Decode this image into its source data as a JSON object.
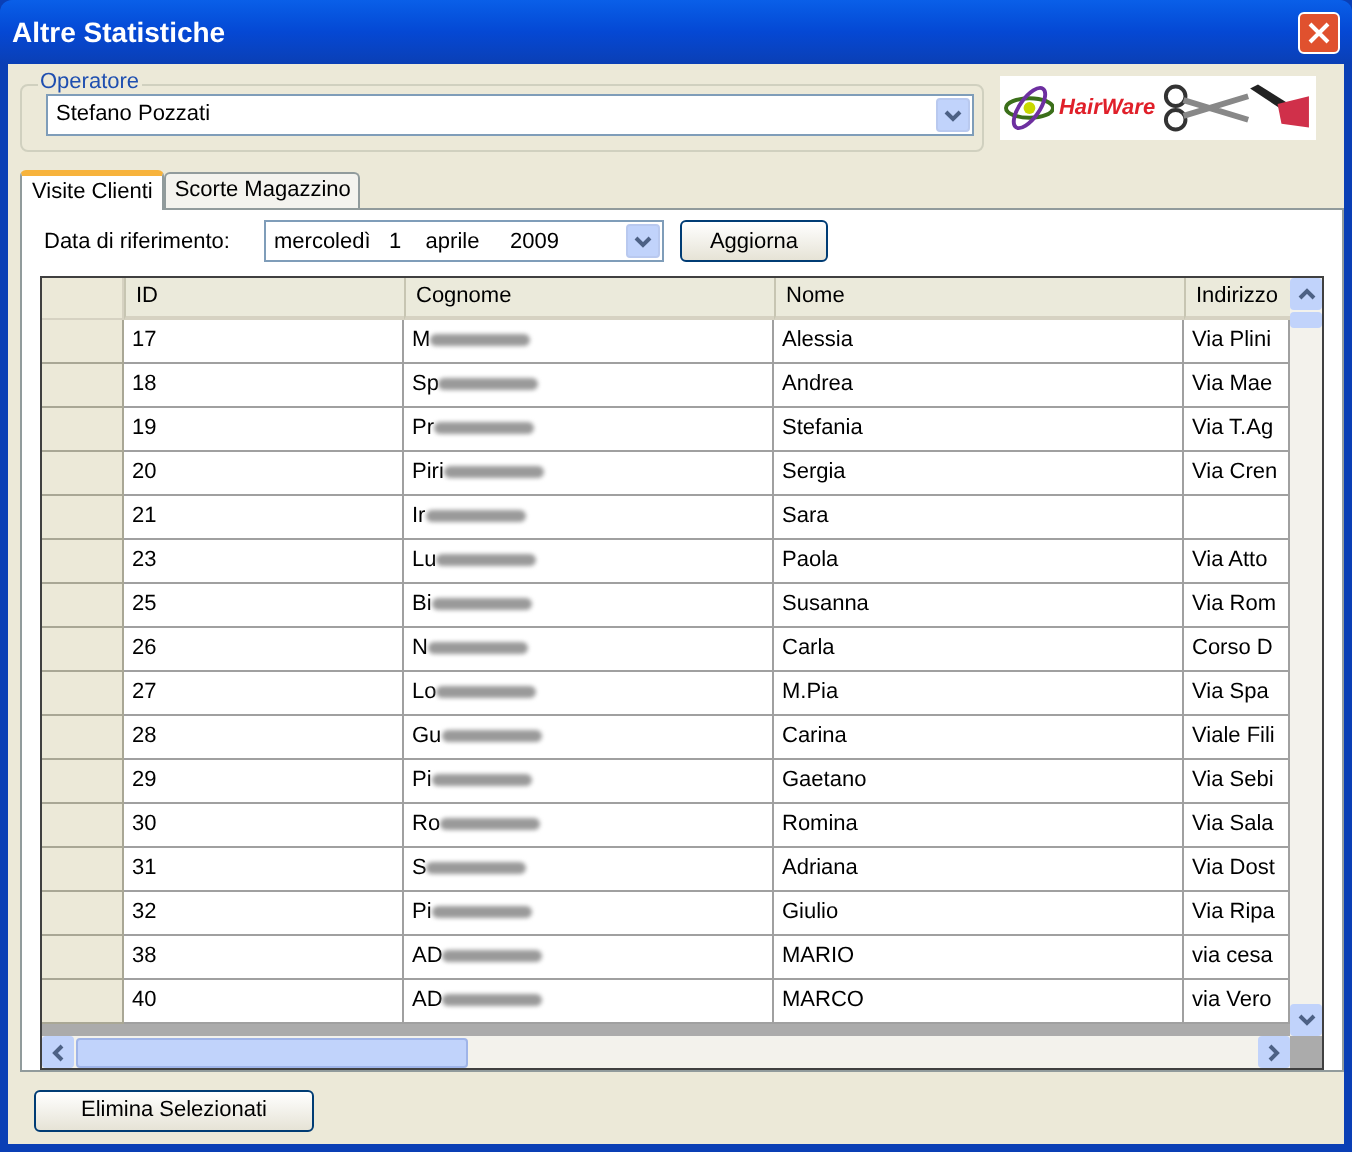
{
  "window": {
    "title": "Altre Statistiche"
  },
  "operator": {
    "label": "Operatore",
    "value": "Stefano Pozzati"
  },
  "logo": {
    "text": "HairWare"
  },
  "tabs": [
    {
      "label": "Visite Clienti",
      "selected": true
    },
    {
      "label": "Scorte Magazzino",
      "selected": false
    }
  ],
  "date_filter": {
    "label": "Data di riferimento:",
    "weekday": "mercoledì",
    "day": "1",
    "month": "aprile",
    "year": "2009",
    "button": "Aggiorna"
  },
  "table": {
    "columns": [
      "ID",
      "Cognome",
      "Nome",
      "Indirizzo"
    ],
    "rows": [
      {
        "id": "17",
        "cognome": "M",
        "nome": "Alessia",
        "indirizzo": "Via Plini"
      },
      {
        "id": "18",
        "cognome": "Sp",
        "nome": "Andrea",
        "indirizzo": "Via Mae"
      },
      {
        "id": "19",
        "cognome": "Pr",
        "nome": "Stefania",
        "indirizzo": "Via T.Ag"
      },
      {
        "id": "20",
        "cognome": "Piri",
        "nome": "Sergia",
        "indirizzo": "Via Cren"
      },
      {
        "id": "21",
        "cognome": "Ir",
        "nome": "Sara"
      },
      {
        "id": "23",
        "cognome": "Lu",
        "nome": "Paola",
        "indirizzo": "Via Atto"
      },
      {
        "id": "25",
        "cognome": "Bi",
        "nome": "Susanna",
        "indirizzo": "Via Rom"
      },
      {
        "id": "26",
        "cognome": "N",
        "nome": "Carla",
        "indirizzo": "Corso D"
      },
      {
        "id": "27",
        "cognome": "Lo",
        "nome": "M.Pia",
        "indirizzo": "Via Spa"
      },
      {
        "id": "28",
        "cognome": "Gu",
        "nome": "Carina",
        "indirizzo": "Viale Fili"
      },
      {
        "id": "29",
        "cognome": "Pi",
        "nome": "Gaetano",
        "indirizzo": "Via Sebi"
      },
      {
        "id": "30",
        "cognome": "Ro",
        "nome": "Romina",
        "indirizzo": "Via Sala"
      },
      {
        "id": "31",
        "cognome": "S",
        "nome": "Adriana",
        "indirizzo": "Via Dost"
      },
      {
        "id": "32",
        "cognome": "Pi",
        "nome": "Giulio",
        "indirizzo": "Via Ripa"
      },
      {
        "id": "38",
        "cognome": "AD",
        "nome": "MARIO",
        "indirizzo": "via cesa"
      },
      {
        "id": "40",
        "cognome": "AD",
        "nome": "MARCO",
        "indirizzo": "via Vero"
      }
    ]
  },
  "delete_button": "Elimina Selezionati"
}
